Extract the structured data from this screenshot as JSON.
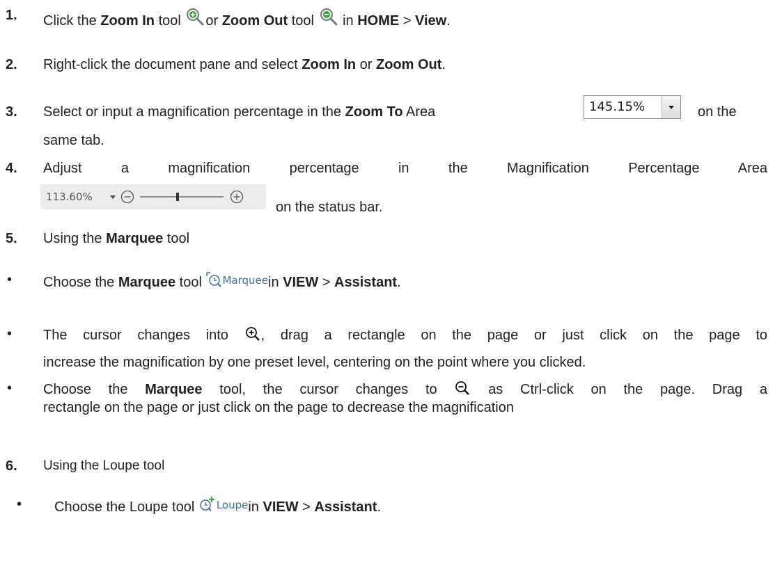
{
  "steps": {
    "s1": {
      "num": "1.",
      "t1": "Click the ",
      "b1": "Zoom In",
      "t2": " tool ",
      "t3": "or ",
      "b2": "Zoom Out",
      "t4": " tool ",
      "t5": " in ",
      "b3": "HOME",
      "t6": " > ",
      "b4": "View",
      "t7": "."
    },
    "s2": {
      "num": "2.",
      "t1": "Right-click the document pane and select ",
      "b1": "Zoom In",
      "t2": " or ",
      "b2": "Zoom Out",
      "t3": "."
    },
    "s3": {
      "num": "3.",
      "t1": "Select or input a magnification percentage in the ",
      "b1": "Zoom To",
      "t2": " Area",
      "t3": "on the",
      "t4": "same tab.",
      "zoom_value": "145.15%"
    },
    "s4": {
      "num": "4.",
      "t1": "Adjust a magnification percentage in the Magnification Percentage Area",
      "t2": "on the status bar.",
      "status_value": "113.60%",
      "slider_level": 0.45
    },
    "s5": {
      "num": "5.",
      "t1": "Using the ",
      "b1": "Marquee",
      "t2": " tool",
      "bullet1": {
        "t1": "Choose the ",
        "b1": "Marquee",
        "t2": " tool ",
        "tool_label": "Marquee",
        "t3": "in ",
        "b2": "VIEW",
        "t4": " > ",
        "b3": "Assistant",
        "t5": "."
      },
      "bullet2": {
        "t1": "The cursor changes into",
        "t2": ", drag a rectangle on the page or just click on the page to",
        "t3": "increase the magnification by one preset level, centering on the point where you clicked."
      },
      "bullet3": {
        "t1": "Choose the ",
        "b1": "Marquee",
        "t2": " tool, the cursor changes to",
        "t3": "as Ctrl-click on the page. Drag a",
        "t4": "rectangle on the page or just click on the page to decrease the magnification"
      }
    },
    "s6": {
      "num": "6.",
      "t1": "Using the Loupe tool",
      "bullet1": {
        "t1": "Choose the Loupe tool ",
        "tool_label": "Loupe",
        "t2": "in ",
        "b1": "VIEW",
        "t3": " > ",
        "b2": "Assistant",
        "t4": "."
      }
    }
  },
  "bullet_char": "•",
  "colors": {
    "icon_green": "#3aa63a",
    "icon_border": "#8a8a8a",
    "accent_blue": "#3d6e9e"
  },
  "icons": [
    "zoom-in-icon",
    "zoom-out-icon",
    "marquee-icon",
    "zoom-in-cursor-icon",
    "zoom-out-cursor-icon",
    "loupe-icon",
    "minus-circle-icon",
    "plus-circle-icon",
    "chevron-down-icon"
  ]
}
